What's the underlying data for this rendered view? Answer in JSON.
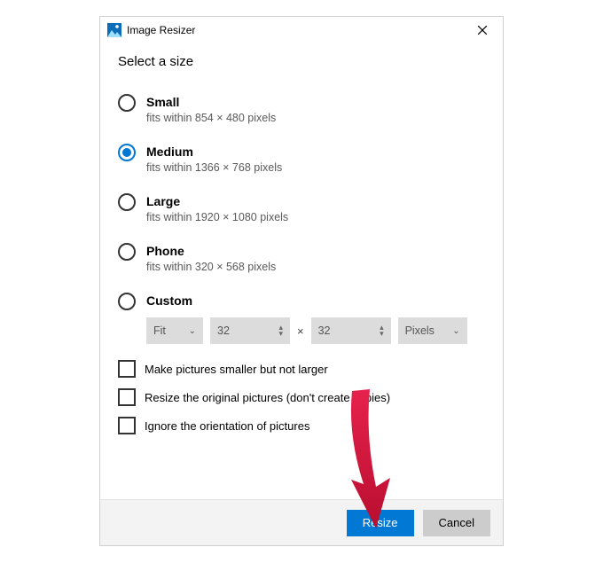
{
  "titlebar": {
    "app_name": "Image Resizer"
  },
  "heading": "Select a size",
  "sizes": [
    {
      "label": "Small",
      "desc": "fits within 854 × 480 pixels"
    },
    {
      "label": "Medium",
      "desc": "fits within 1366 × 768 pixels"
    },
    {
      "label": "Large",
      "desc": "fits within 1920 × 1080 pixels"
    },
    {
      "label": "Phone",
      "desc": "fits within 320 × 568 pixels"
    },
    {
      "label": "Custom",
      "desc": ""
    }
  ],
  "selected_index": 1,
  "custom": {
    "fit_label": "Fit",
    "width": "32",
    "height": "32",
    "multiply": "×",
    "unit_label": "Pixels"
  },
  "checkboxes": [
    "Make pictures smaller but not larger",
    "Resize the original pictures (don't create copies)",
    "Ignore the orientation of pictures"
  ],
  "buttons": {
    "resize": "Resize",
    "cancel": "Cancel"
  },
  "colors": {
    "accent": "#0078d4",
    "arrow": "#d11235"
  }
}
